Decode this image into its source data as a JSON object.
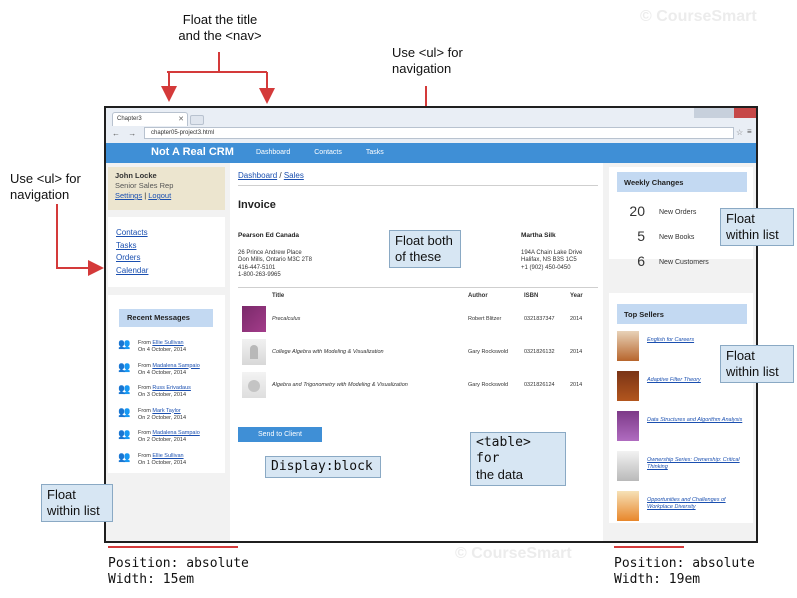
{
  "annotations": {
    "float_title_nav": [
      "Float the title",
      "and the <nav>"
    ],
    "use_ul_top": [
      "Use <ul> for",
      "navigation"
    ],
    "use_ul_left": [
      "Use <ul> for",
      "navigation"
    ],
    "float_both": [
      "Float both",
      "of these"
    ],
    "float_within_list_right1": [
      "Float",
      "within list"
    ],
    "float_within_list_right2": [
      "Float",
      "within list"
    ],
    "float_within_list_left": [
      "Float",
      "within list"
    ],
    "display_block": "Display:block",
    "table_for_data": [
      "<table> for",
      "the data"
    ],
    "footer_left": [
      "Position: absolute",
      "Width: 15em"
    ],
    "footer_right": [
      "Position: absolute",
      "Width: 19em"
    ],
    "watermark": "© CourseSmart"
  },
  "browser": {
    "tab_title": "Chapter3",
    "url": "chapter05-project3.html",
    "nav_buttons": "← → C"
  },
  "app": {
    "brand": "Not A Real CRM",
    "nav": [
      "Dashboard",
      "Contacts",
      "Tasks"
    ],
    "user": {
      "name": "John Locke",
      "role": "Senior Sales Rep",
      "settings": "Settings",
      "separator": " | ",
      "logout": "Logout"
    },
    "sidenav": [
      "Contacts",
      "Tasks",
      "Orders",
      "Calendar"
    ],
    "recent_messages": {
      "title": "Recent Messages",
      "items": [
        {
          "from": "From ",
          "name": "Ellie Sullivan",
          "date": "On 4 October, 2014"
        },
        {
          "from": "From ",
          "name": "Madalena Sampaio",
          "date": "On 4 October, 2014"
        },
        {
          "from": "From ",
          "name": "Russ Erivadaus",
          "date": "On 3 October, 2014"
        },
        {
          "from": "From ",
          "name": "Mark Taylor",
          "date": "On 2 October, 2014"
        },
        {
          "from": "From ",
          "name": "Madalena Sampaio",
          "date": "On 2 October, 2014"
        },
        {
          "from": "From ",
          "name": "Ellie Sullivan",
          "date": "On 1 October, 2014"
        }
      ]
    },
    "breadcrumb": {
      "home": "Dashboard",
      "sep": " / ",
      "current": "Sales"
    },
    "invoice": {
      "title": "Invoice",
      "from": {
        "name": "Pearson Ed Canada",
        "lines": [
          "26 Prince Andrew Place",
          "Don Mills, Ontario M3C 2T8",
          "416-447-5101",
          "1-800-263-9965"
        ]
      },
      "to": {
        "name": "Martha Silk",
        "lines": [
          "194A Chain Lake Drive",
          "Halifax, NS B3S 1C5",
          "+1 (902) 450-0450"
        ]
      },
      "columns": [
        "",
        "Title",
        "Author",
        "ISBN",
        "Year"
      ],
      "rows": [
        {
          "title": "Precalculus",
          "author": "Robert Blitzer",
          "isbn": "0321837347",
          "year": "2014"
        },
        {
          "title": "College Algebra with Modeling & Visualization",
          "author": "Gary Rockswold",
          "isbn": "0321826132",
          "year": "2014"
        },
        {
          "title": "Algebra and Trigonometry with Modeling & Visualization",
          "author": "Gary Rockswold",
          "isbn": "0321826124",
          "year": "2014"
        }
      ],
      "send_label": "Send to Client"
    },
    "weekly_changes": {
      "title": "Weekly Changes",
      "items": [
        {
          "num": "20",
          "label": "New Orders"
        },
        {
          "num": "5",
          "label": "New Books"
        },
        {
          "num": "6",
          "label": "New Customers"
        }
      ]
    },
    "top_sellers": {
      "title": "Top Sellers",
      "items": [
        "English for Careers",
        "Adaptive Filter Theory",
        "Data Structures and Algorithm Analysis",
        "Ownership Series: Ownership: Critical Thinking",
        "Opportunities and Challenges of Workplace Diversity"
      ]
    }
  },
  "colors": {
    "accent": "#3f8fd6",
    "callout_red": "#d43a3a",
    "callout_box": "#d7e6f3"
  }
}
